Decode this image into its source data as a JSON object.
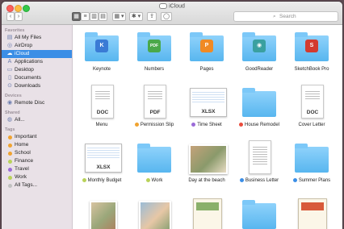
{
  "window": {
    "title": "iCloud"
  },
  "toolbar": {
    "back": "‹",
    "forward": "›",
    "views": [
      "▦",
      "≡",
      "▥",
      "▤"
    ],
    "arrange": "▦ ▾",
    "action": "✱ ▾",
    "share": "⇪",
    "tags": "◯",
    "search_placeholder": "Search",
    "search_icon": "⌕"
  },
  "sidebar": {
    "favorites_title": "Favorites",
    "favorites": [
      {
        "label": "All My Files",
        "icon": "▤"
      },
      {
        "label": "AirDrop",
        "icon": "◎"
      },
      {
        "label": "iCloud",
        "icon": "☁"
      },
      {
        "label": "Applications",
        "icon": "A"
      },
      {
        "label": "Desktop",
        "icon": "▭"
      },
      {
        "label": "Documents",
        "icon": "▯"
      },
      {
        "label": "Downloads",
        "icon": "⊙"
      }
    ],
    "devices_title": "Devices",
    "devices": [
      {
        "label": "Remote Disc",
        "icon": "◉"
      }
    ],
    "shared_title": "Shared",
    "shared": [
      {
        "label": "All...",
        "icon": "◍"
      }
    ],
    "tags_title": "Tags",
    "tags": [
      {
        "label": "Important",
        "color": "#f0a330"
      },
      {
        "label": "Home",
        "color": "#f0a330"
      },
      {
        "label": "School",
        "color": "#f0a330"
      },
      {
        "label": "Finance",
        "color": "#b9d25a"
      },
      {
        "label": "Travel",
        "color": "#9b6bd8"
      },
      {
        "label": "Work",
        "color": "#b9d25a"
      },
      {
        "label": "All Tags...",
        "color": "#c0c0c0"
      }
    ]
  },
  "files": {
    "row1": [
      {
        "name": "Keynote",
        "badge": "K",
        "badge_color": "#3a7bd5"
      },
      {
        "name": "Numbers",
        "badge": "PDF",
        "badge_color": "#4aa84a"
      },
      {
        "name": "Pages",
        "badge": "P",
        "badge_color": "#f08a24"
      },
      {
        "name": "GoodReader",
        "badge": "◉",
        "badge_color": "#3aa0a0"
      },
      {
        "name": "SketchBook Pro",
        "badge": "S",
        "badge_color": "#d33a2f"
      }
    ],
    "row2": [
      {
        "name": "Menu",
        "label": "DOC"
      },
      {
        "name": "Permission Slip",
        "label": "PDF",
        "tag_color": "#f0a330"
      },
      {
        "name": "Time Sheet",
        "label": "XLSX",
        "tag_color": "#9b6bd8"
      },
      {
        "name": "House Remodel",
        "tag_color": "#e94b3c"
      },
      {
        "name": "Cover Letter",
        "label": "DOC"
      }
    ],
    "row3": [
      {
        "name": "Monthly Budget",
        "label": "XLSX",
        "tag_color": "#b9d25a"
      },
      {
        "name": "Work",
        "tag_color": "#b9d25a"
      },
      {
        "name": "Day at the beach"
      },
      {
        "name": "Business Letter",
        "tag_color": "#3b8ee6"
      },
      {
        "name": "Summer Plans",
        "tag_color": "#3b8ee6"
      }
    ]
  },
  "colors": {
    "selection": "#3b8ee6",
    "folder": "#6cc0f4"
  }
}
